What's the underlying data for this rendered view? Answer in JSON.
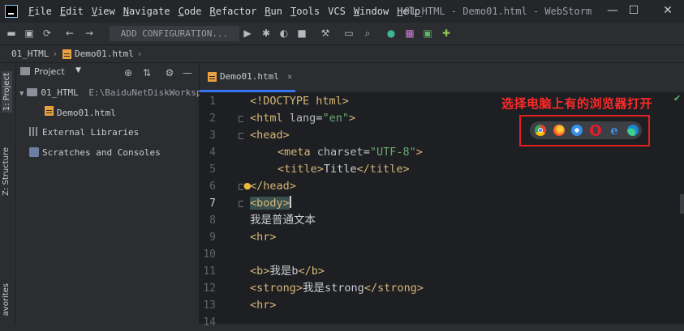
{
  "menubar": {
    "items": [
      {
        "label": "File",
        "u": "F",
        "rest": "ile"
      },
      {
        "label": "Edit",
        "u": "E",
        "rest": "dit"
      },
      {
        "label": "View",
        "u": "V",
        "rest": "iew"
      },
      {
        "label": "Navigate",
        "u": "N",
        "rest": "avigate"
      },
      {
        "label": "Code",
        "u": "C",
        "rest": "ode"
      },
      {
        "label": "Refactor",
        "u": "R",
        "rest": "efactor"
      },
      {
        "label": "Run",
        "u": "R",
        "rest": "un"
      },
      {
        "label": "Tools",
        "u": "T",
        "rest": "ools"
      },
      {
        "label": "VCS",
        "u": "",
        "rest": "VCS"
      },
      {
        "label": "Window",
        "u": "W",
        "rest": "indow"
      },
      {
        "label": "Help",
        "u": "H",
        "rest": "elp"
      }
    ],
    "window_title": "01_HTML - Demo01.html - WebStorm",
    "controls": {
      "minimize": "—",
      "maximize": "☐",
      "close": "✕"
    }
  },
  "toolbar": {
    "add_configuration": "ADD CONFIGURATION..."
  },
  "breadcrumb": {
    "project": "01_HTML",
    "file": "Demo01.html"
  },
  "left_stripe": {
    "project_tab": "1: Project",
    "structure_tab": "Z: Structure",
    "favorites_tab": "avorites"
  },
  "project_panel": {
    "title": "Project",
    "root_name": "01_HTML",
    "root_path": "E:\\BaiduNetDiskWorkspa",
    "file": "Demo01.html",
    "external_libraries": "External Libraries",
    "scratches": "Scratches and Consoles"
  },
  "editor": {
    "tab_label": "Demo01.html",
    "tab_close": "×",
    "active_line": 7,
    "line_numbers": [
      "1",
      "2",
      "3",
      "4",
      "5",
      "6",
      "7",
      "8",
      "9",
      "10",
      "11",
      "12",
      "13",
      "14"
    ],
    "lines": {
      "l1_tag": "<!DOCTYPE html>",
      "l2_open": "<html ",
      "l2_attr": "lang",
      "l2_eq": "=",
      "l2_val": "\"en\"",
      "l2_close": ">",
      "l3": "<head>",
      "l4_open": "<meta ",
      "l4_attr": "charset",
      "l4_eq": "=",
      "l4_val": "\"UTF-8\"",
      "l4_close": ">",
      "l5_open": "<title>",
      "l5_text": "Title",
      "l5_close": "</title>",
      "l6_lt": "<",
      "l6_rest": "/head>",
      "l7": "<body>",
      "l8": "我是普通文本",
      "l9": "<hr>",
      "l11_open": "<b>",
      "l11_text": "我是b",
      "l11_close": "</b>",
      "l12_open": "<strong>",
      "l12_text": "我是strong",
      "l12_close": "</strong>",
      "l13": "<hr>"
    }
  },
  "annotation": {
    "text": "选择电脑上有的浏览器打开"
  },
  "browsers": [
    "chrome-icon",
    "firefox-icon",
    "safari-icon",
    "opera-icon",
    "ie-icon",
    "edge-icon"
  ],
  "colors": {
    "accent": "#3574f0",
    "annotation_red": "#ff2a2a",
    "tag": "#d5b778",
    "string": "#6aab73"
  }
}
